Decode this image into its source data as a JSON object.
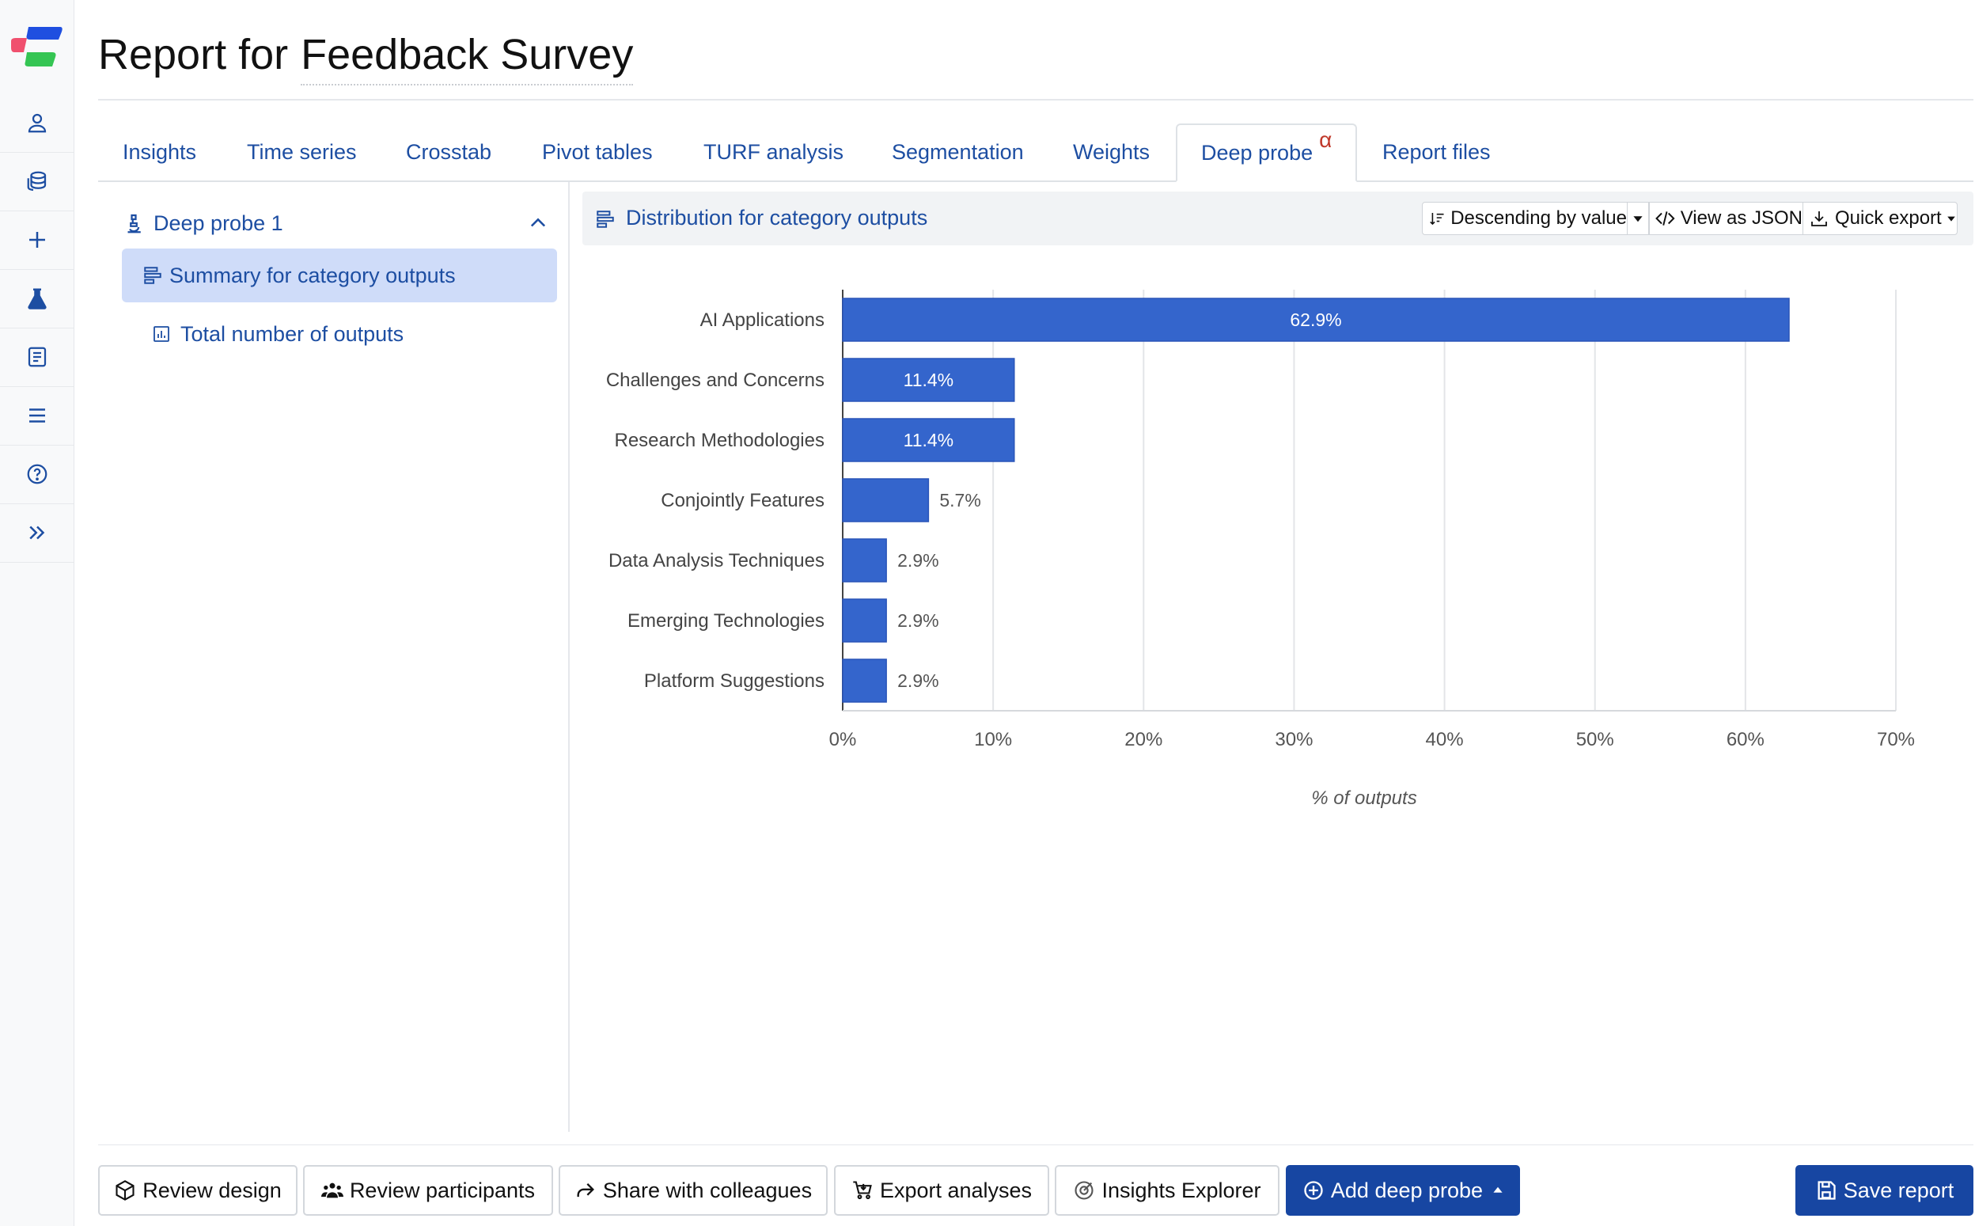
{
  "header": {
    "title_prefix": "Report for",
    "survey_name": "Feedback Survey"
  },
  "sidebar": {
    "icons": [
      "user-icon",
      "database-icon",
      "plus-icon",
      "flask-icon",
      "notebook-icon",
      "menu-icon",
      "help-icon",
      "expand-icon"
    ]
  },
  "tabs": [
    {
      "label": "Insights"
    },
    {
      "label": "Time series"
    },
    {
      "label": "Crosstab"
    },
    {
      "label": "Pivot tables"
    },
    {
      "label": "TURF analysis"
    },
    {
      "label": "Segmentation"
    },
    {
      "label": "Weights"
    },
    {
      "label": "Deep probe",
      "badge": "α",
      "active": true
    },
    {
      "label": "Report files"
    }
  ],
  "left_panel": {
    "probe_title": "Deep probe 1",
    "items": [
      {
        "label": "Summary for category outputs",
        "active": true
      },
      {
        "label": "Total number of outputs"
      }
    ]
  },
  "chart_panel": {
    "title": "Distribution for category outputs",
    "sort_label": "Descending by value",
    "json_label": "View as JSON",
    "export_label": "Quick export"
  },
  "chart_data": {
    "type": "bar",
    "orientation": "horizontal",
    "categories": [
      "AI Applications",
      "Challenges and Concerns",
      "Research Methodologies",
      "Conjointly Features",
      "Data Analysis Techniques",
      "Emerging Technologies",
      "Platform Suggestions"
    ],
    "values": [
      62.9,
      11.4,
      11.4,
      5.7,
      2.9,
      2.9,
      2.9
    ],
    "value_labels": [
      "62.9%",
      "11.4%",
      "11.4%",
      "5.7%",
      "2.9%",
      "2.9%",
      "2.9%"
    ],
    "xlim": [
      0,
      70
    ],
    "xticks": [
      "0%",
      "10%",
      "20%",
      "30%",
      "40%",
      "50%",
      "60%",
      "70%"
    ],
    "xlabel": "% of outputs",
    "grid": true,
    "bar_color": "#3465cc"
  },
  "bottom_bar": {
    "review_design": "Review design",
    "review_participants": "Review participants",
    "share": "Share with colleagues",
    "export": "Export analyses",
    "insights_explorer": "Insights Explorer",
    "add_probe": "Add deep probe",
    "save": "Save report"
  },
  "colors": {
    "accent": "#1d4ea2",
    "primary_button": "#1746a2",
    "bar": "#3465cc",
    "active_nav": "#cfdcf9",
    "alpha_badge": "#c0392b"
  }
}
